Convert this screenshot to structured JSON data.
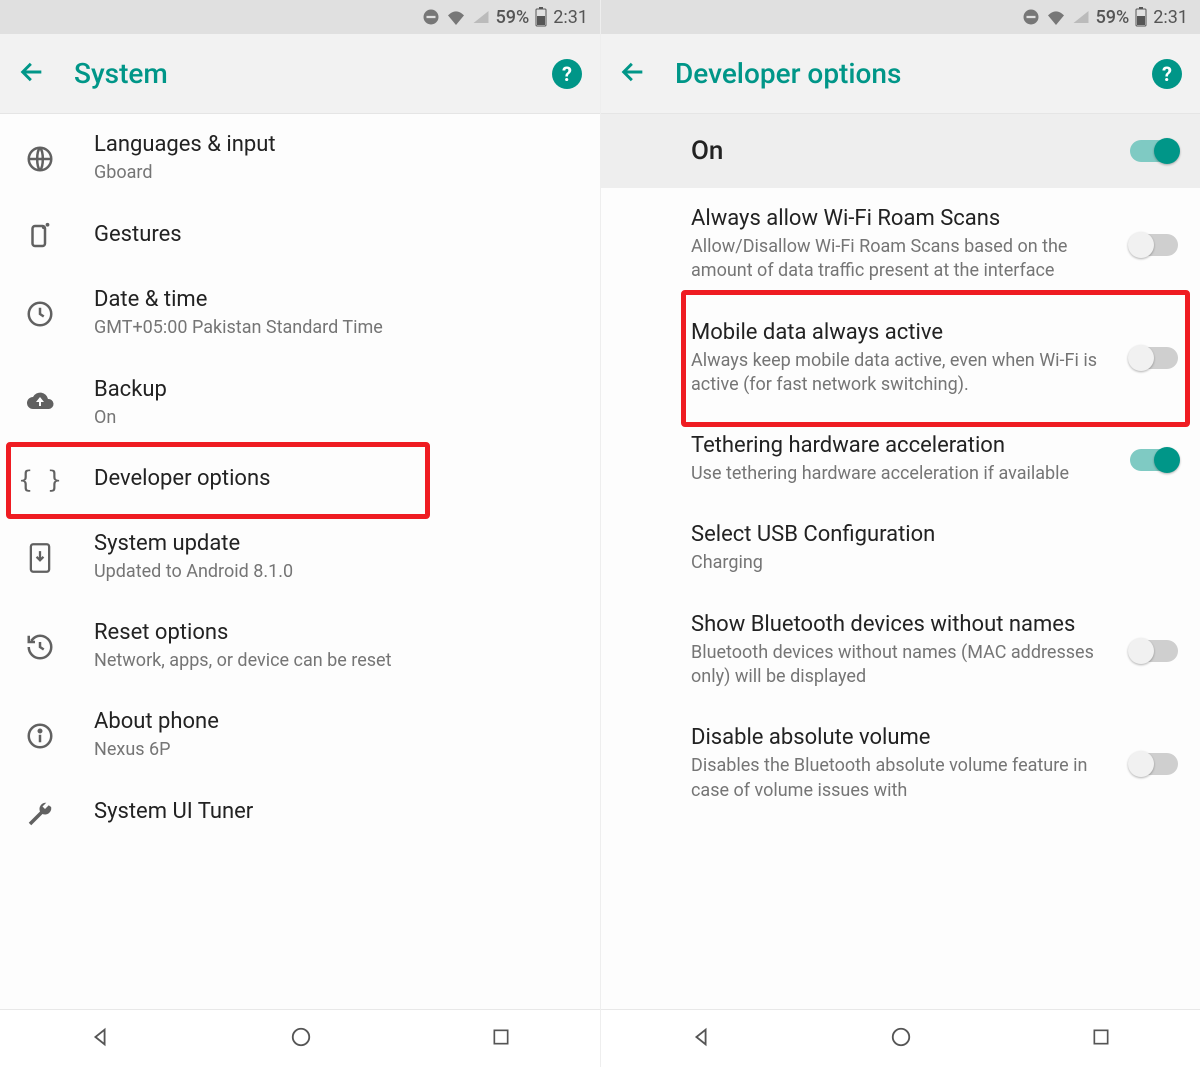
{
  "status": {
    "battery_pct": "59%",
    "time": "2:31"
  },
  "left": {
    "title": "System",
    "items": [
      {
        "icon": "globe",
        "title": "Languages & input",
        "sub": "Gboard"
      },
      {
        "icon": "gesture",
        "title": "Gestures",
        "sub": ""
      },
      {
        "icon": "clock",
        "title": "Date & time",
        "sub": "GMT+05:00 Pakistan Standard Time"
      },
      {
        "icon": "cloud",
        "title": "Backup",
        "sub": "On"
      },
      {
        "icon": "braces",
        "title": "Developer options",
        "sub": "",
        "highlight": true
      },
      {
        "icon": "download",
        "title": "System update",
        "sub": "Updated to Android 8.1.0"
      },
      {
        "icon": "restore",
        "title": "Reset options",
        "sub": "Network, apps, or device can be reset"
      },
      {
        "icon": "info",
        "title": "About phone",
        "sub": "Nexus 6P"
      },
      {
        "icon": "wrench",
        "title": "System UI Tuner",
        "sub": ""
      }
    ]
  },
  "right": {
    "title": "Developer options",
    "master_label": "On",
    "master_on": true,
    "items": [
      {
        "title": "Always allow Wi-Fi Roam Scans",
        "sub": "Allow/Disallow Wi-Fi Roam Scans based on the amount of data traffic present at the interface",
        "toggle": "off"
      },
      {
        "title": "Mobile data always active",
        "sub": "Always keep mobile data active, even when Wi-Fi is active (for fast network switching).",
        "toggle": "off",
        "highlight": true
      },
      {
        "title": "Tethering hardware acceleration",
        "sub": "Use tethering hardware acceleration if available",
        "toggle": "on"
      },
      {
        "title": "Select USB Configuration",
        "sub": "Charging",
        "toggle": null
      },
      {
        "title": "Show Bluetooth devices without names",
        "sub": "Bluetooth devices without names (MAC addresses only) will be displayed",
        "toggle": "off"
      },
      {
        "title": "Disable absolute volume",
        "sub": "Disables the Bluetooth absolute volume feature in case of volume issues with",
        "toggle": "off"
      }
    ]
  },
  "colors": {
    "accent": "#009688",
    "highlight": "#ef1c22"
  }
}
